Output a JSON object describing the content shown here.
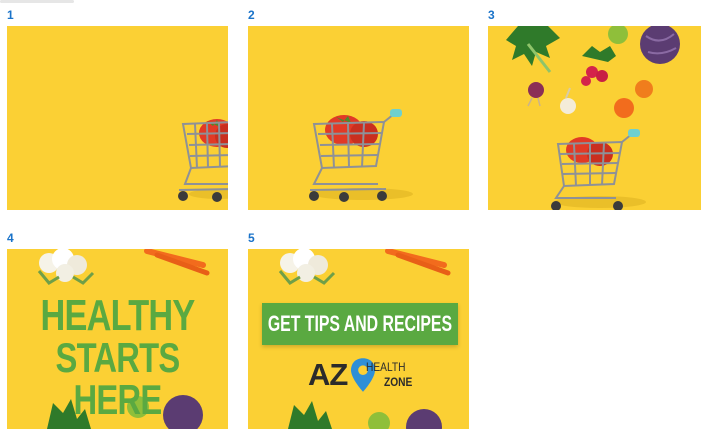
{
  "frames": [
    {
      "number": "1"
    },
    {
      "number": "2"
    },
    {
      "number": "3"
    },
    {
      "number": "4",
      "headline_line1": "HEALTHY",
      "headline_line2": "STARTS HERE"
    },
    {
      "number": "5",
      "cta": "GET TIPS AND RECIPES",
      "logo_az": "AZ",
      "logo_health": "HEALTH",
      "logo_zone": "ZONE"
    }
  ],
  "colors": {
    "background": "#fbd034",
    "frame_number": "#1a73c9",
    "headline_green": "#5aa941",
    "logo_pin_blue": "#2e8fd6",
    "tomato": "#e13a26",
    "cabbage": "#5b3c72"
  }
}
